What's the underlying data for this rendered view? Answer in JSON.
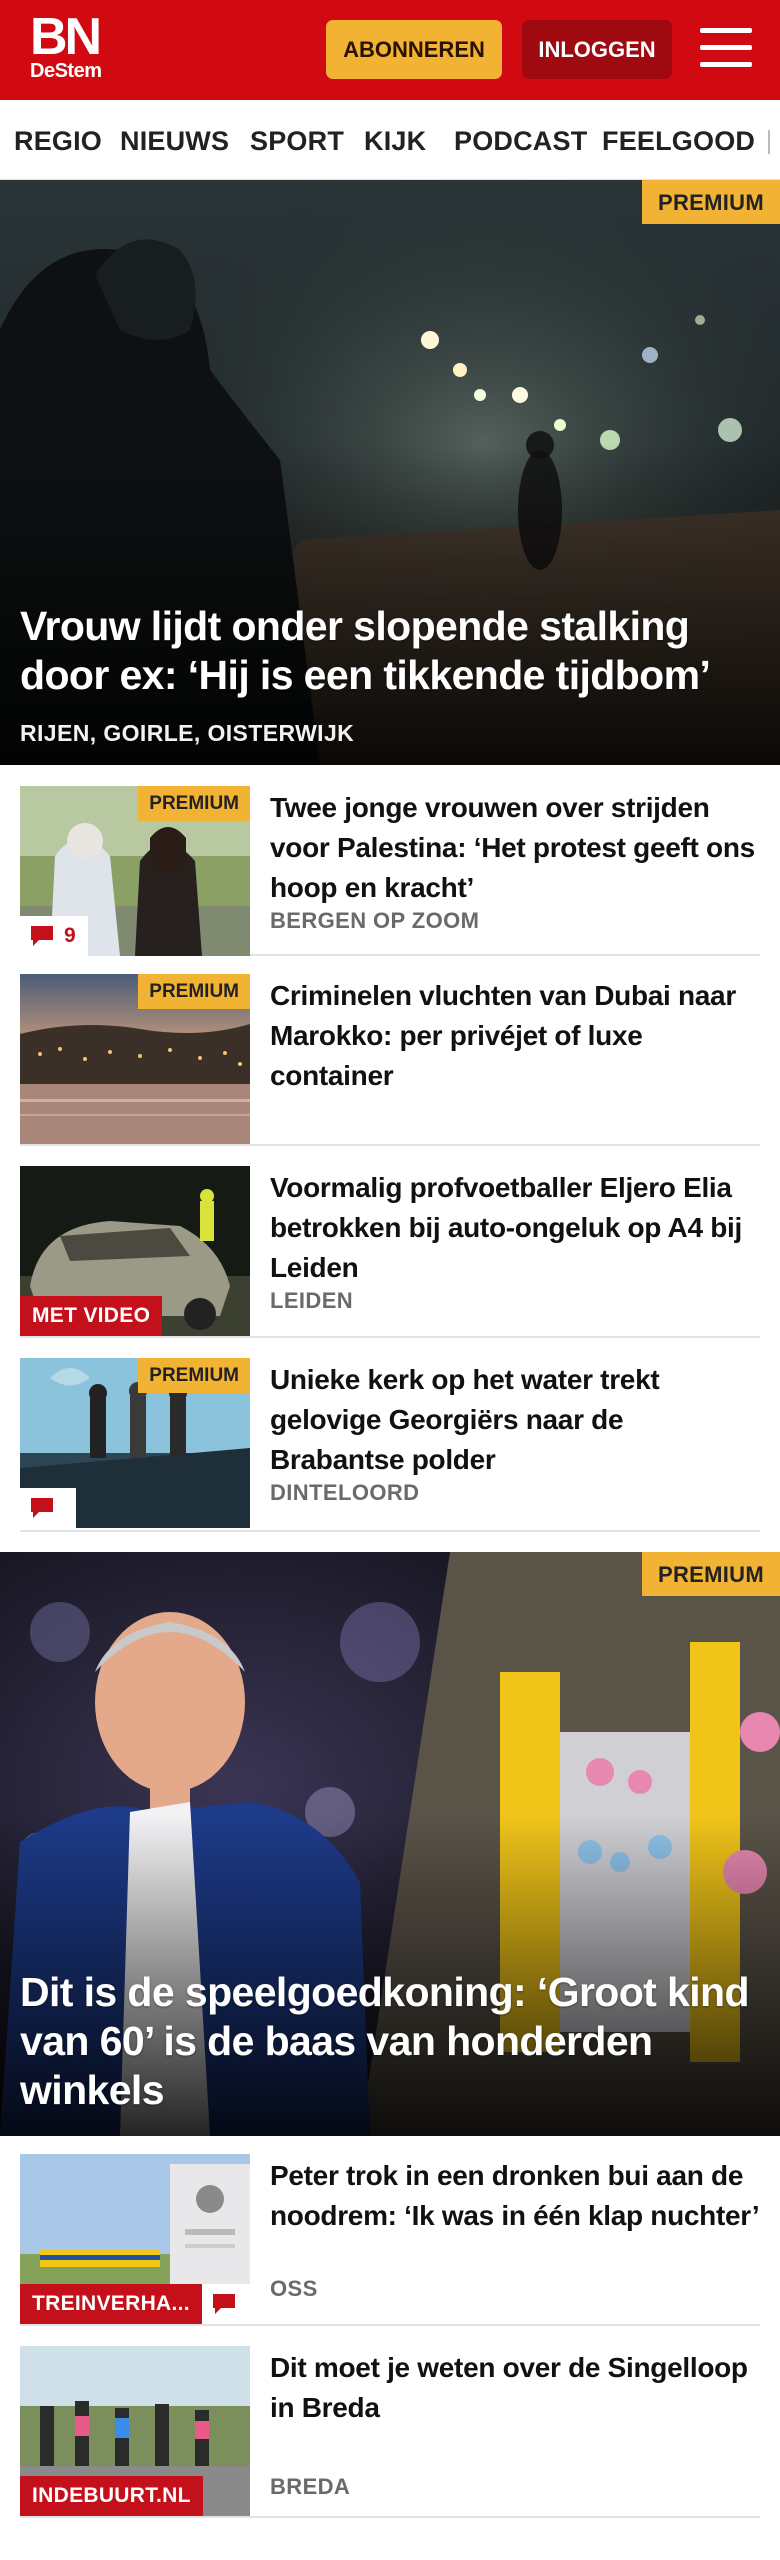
{
  "brand": {
    "logo_main": "BN",
    "logo_sub": "DeStem",
    "color": "#d10a11"
  },
  "header": {
    "subscribe_label": "ABONNEREN",
    "login_label": "INLOGGEN",
    "menu_icon": "hamburger-menu-icon"
  },
  "nav": {
    "items": [
      "REGIO",
      "NIEUWS",
      "SPORT",
      "KIJK",
      "PODCAST",
      "FEELGOOD"
    ]
  },
  "hero1": {
    "badge": "PREMIUM",
    "title": "Vrouw lijdt onder slopende stalking door ex: ‘Hij is een tikkende tijdbom’",
    "location": "RIJEN, GOIRLE, OISTERWIJK"
  },
  "articles1": [
    {
      "badge": "PREMIUM",
      "comments": "9",
      "title": "Twee jonge vrouwen over strijden voor Palestina: ‘Het protest geeft ons hoop en kracht’",
      "location": "BERGEN OP ZOOM"
    },
    {
      "badge": "PREMIUM",
      "title": "Criminelen vluchten van Dubai naar Marokko: per privéjet of luxe container",
      "location": ""
    },
    {
      "tag": "MET VIDEO",
      "title": "Voormalig profvoetballer Eljero Elia betrokken bij auto-ongeluk op A4 bij Leiden",
      "location": "LEIDEN"
    },
    {
      "badge": "PREMIUM",
      "comments": "",
      "title": "Unieke kerk op het water trekt gelovige Georgiërs naar de Brabantse polder",
      "location": "DINTELOORD"
    }
  ],
  "hero2": {
    "badge": "PREMIUM",
    "title": "Dit is de speelgoedkoning: ‘Groot kind van 60’ is de baas van honderden winkels"
  },
  "articles2": [
    {
      "tag": "TREINVERHA...",
      "comments": "",
      "title": "Peter trok in een dronken bui aan de noodrem: ‘Ik was in één klap nuchter’",
      "location": "OSS"
    },
    {
      "tag": "INDEBUURT.NL",
      "title": "Dit moet je weten over de Singelloop in Breda",
      "location": "BREDA"
    }
  ]
}
